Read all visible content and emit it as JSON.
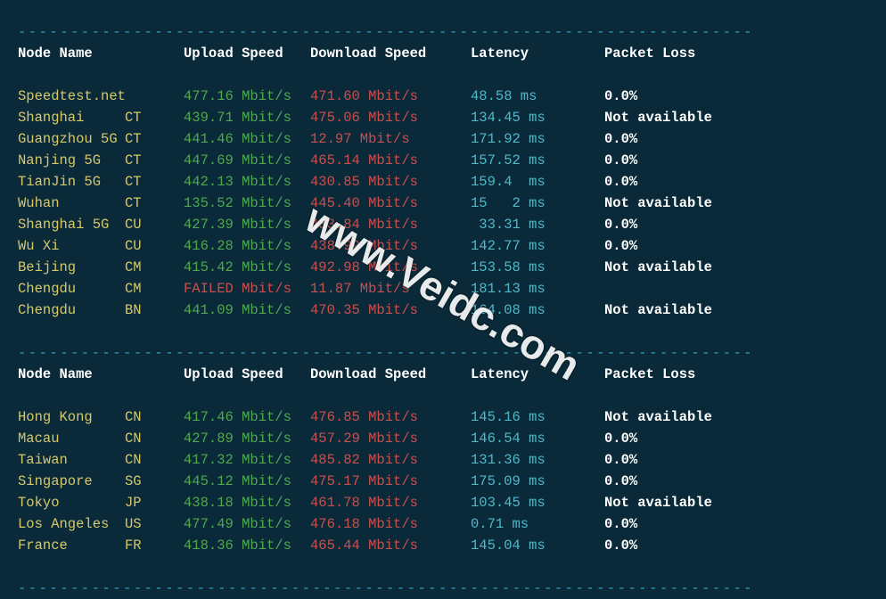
{
  "headers": {
    "node": "Node Name",
    "upload": "Upload Speed",
    "download": "Download Speed",
    "latency": "Latency",
    "loss": "Packet Loss"
  },
  "dashline": "----------------------------------------------------------------------",
  "watermark": "www.Veidc.com",
  "group1": [
    {
      "node": "Speedtest.net",
      "cc": "",
      "up": "477.16 Mbit/s",
      "dn": "471.60 Mbit/s",
      "lat": "48.58 ms",
      "pl": "0.0%"
    },
    {
      "node": "Shanghai",
      "cc": "CT",
      "up": "439.71 Mbit/s",
      "dn": "475.06 Mbit/s",
      "lat": "134.45 ms",
      "pl": "Not available"
    },
    {
      "node": "Guangzhou 5G",
      "cc": "CT",
      "up": "441.46 Mbit/s",
      "dn": "12.97 Mbit/s",
      "lat": "171.92 ms",
      "pl": "0.0%"
    },
    {
      "node": "Nanjing 5G",
      "cc": "CT",
      "up": "447.69 Mbit/s",
      "dn": "465.14 Mbit/s",
      "lat": "157.52 ms",
      "pl": "0.0%"
    },
    {
      "node": "TianJin 5G",
      "cc": "CT",
      "up": "442.13 Mbit/s",
      "dn": "430.85 Mbit/s",
      "lat": "159.4  ms",
      "pl": "0.0%"
    },
    {
      "node": "Wuhan",
      "cc": "CT",
      "up": "135.52 Mbit/s",
      "dn": "445.40 Mbit/s",
      "lat": "15   2 ms",
      "pl": "Not available"
    },
    {
      "node": "Shanghai 5G",
      "cc": "CU",
      "up": "427.39 Mbit/s",
      "dn": "433.84 Mbit/s",
      "lat": " 33.31 ms",
      "pl": "0.0%"
    },
    {
      "node": "Wu Xi",
      "cc": "CU",
      "up": "416.28 Mbit/s",
      "dn": "438.99 Mbit/s",
      "lat": "142.77 ms",
      "pl": "0.0%"
    },
    {
      "node": "Beijing",
      "cc": "CM",
      "up": "415.42 Mbit/s",
      "dn": "492.98 Mbit/s",
      "lat": "153.58 ms",
      "pl": "Not available"
    },
    {
      "node": "Chengdu",
      "cc": "CM",
      "up": "FAILED Mbit/s",
      "dn": "11.87 Mbit/s",
      "lat": "181.13 ms",
      "pl": ""
    },
    {
      "node": "Chengdu",
      "cc": "BN",
      "up": "441.09 Mbit/s",
      "dn": "470.35 Mbit/s",
      "lat": "164.08 ms",
      "pl": "Not available"
    }
  ],
  "group2": [
    {
      "node": "Hong Kong",
      "cc": "CN",
      "up": "417.46 Mbit/s",
      "dn": "476.85 Mbit/s",
      "lat": "145.16 ms",
      "pl": "Not available"
    },
    {
      "node": "Macau",
      "cc": "CN",
      "up": "427.89 Mbit/s",
      "dn": "457.29 Mbit/s",
      "lat": "146.54 ms",
      "pl": "0.0%"
    },
    {
      "node": "Taiwan",
      "cc": "CN",
      "up": "417.32 Mbit/s",
      "dn": "485.82 Mbit/s",
      "lat": "131.36 ms",
      "pl": "0.0%"
    },
    {
      "node": "Singapore",
      "cc": "SG",
      "up": "445.12 Mbit/s",
      "dn": "475.17 Mbit/s",
      "lat": "175.09 ms",
      "pl": "0.0%"
    },
    {
      "node": "Tokyo",
      "cc": "JP",
      "up": "438.18 Mbit/s",
      "dn": "461.78 Mbit/s",
      "lat": "103.45 ms",
      "pl": "Not available"
    },
    {
      "node": "Los Angeles",
      "cc": "US",
      "up": "477.49 Mbit/s",
      "dn": "476.18 Mbit/s",
      "lat": "0.71 ms",
      "pl": "0.0%"
    },
    {
      "node": "France",
      "cc": "FR",
      "up": "418.36 Mbit/s",
      "dn": "465.44 Mbit/s",
      "lat": "145.04 ms",
      "pl": "0.0%"
    }
  ]
}
